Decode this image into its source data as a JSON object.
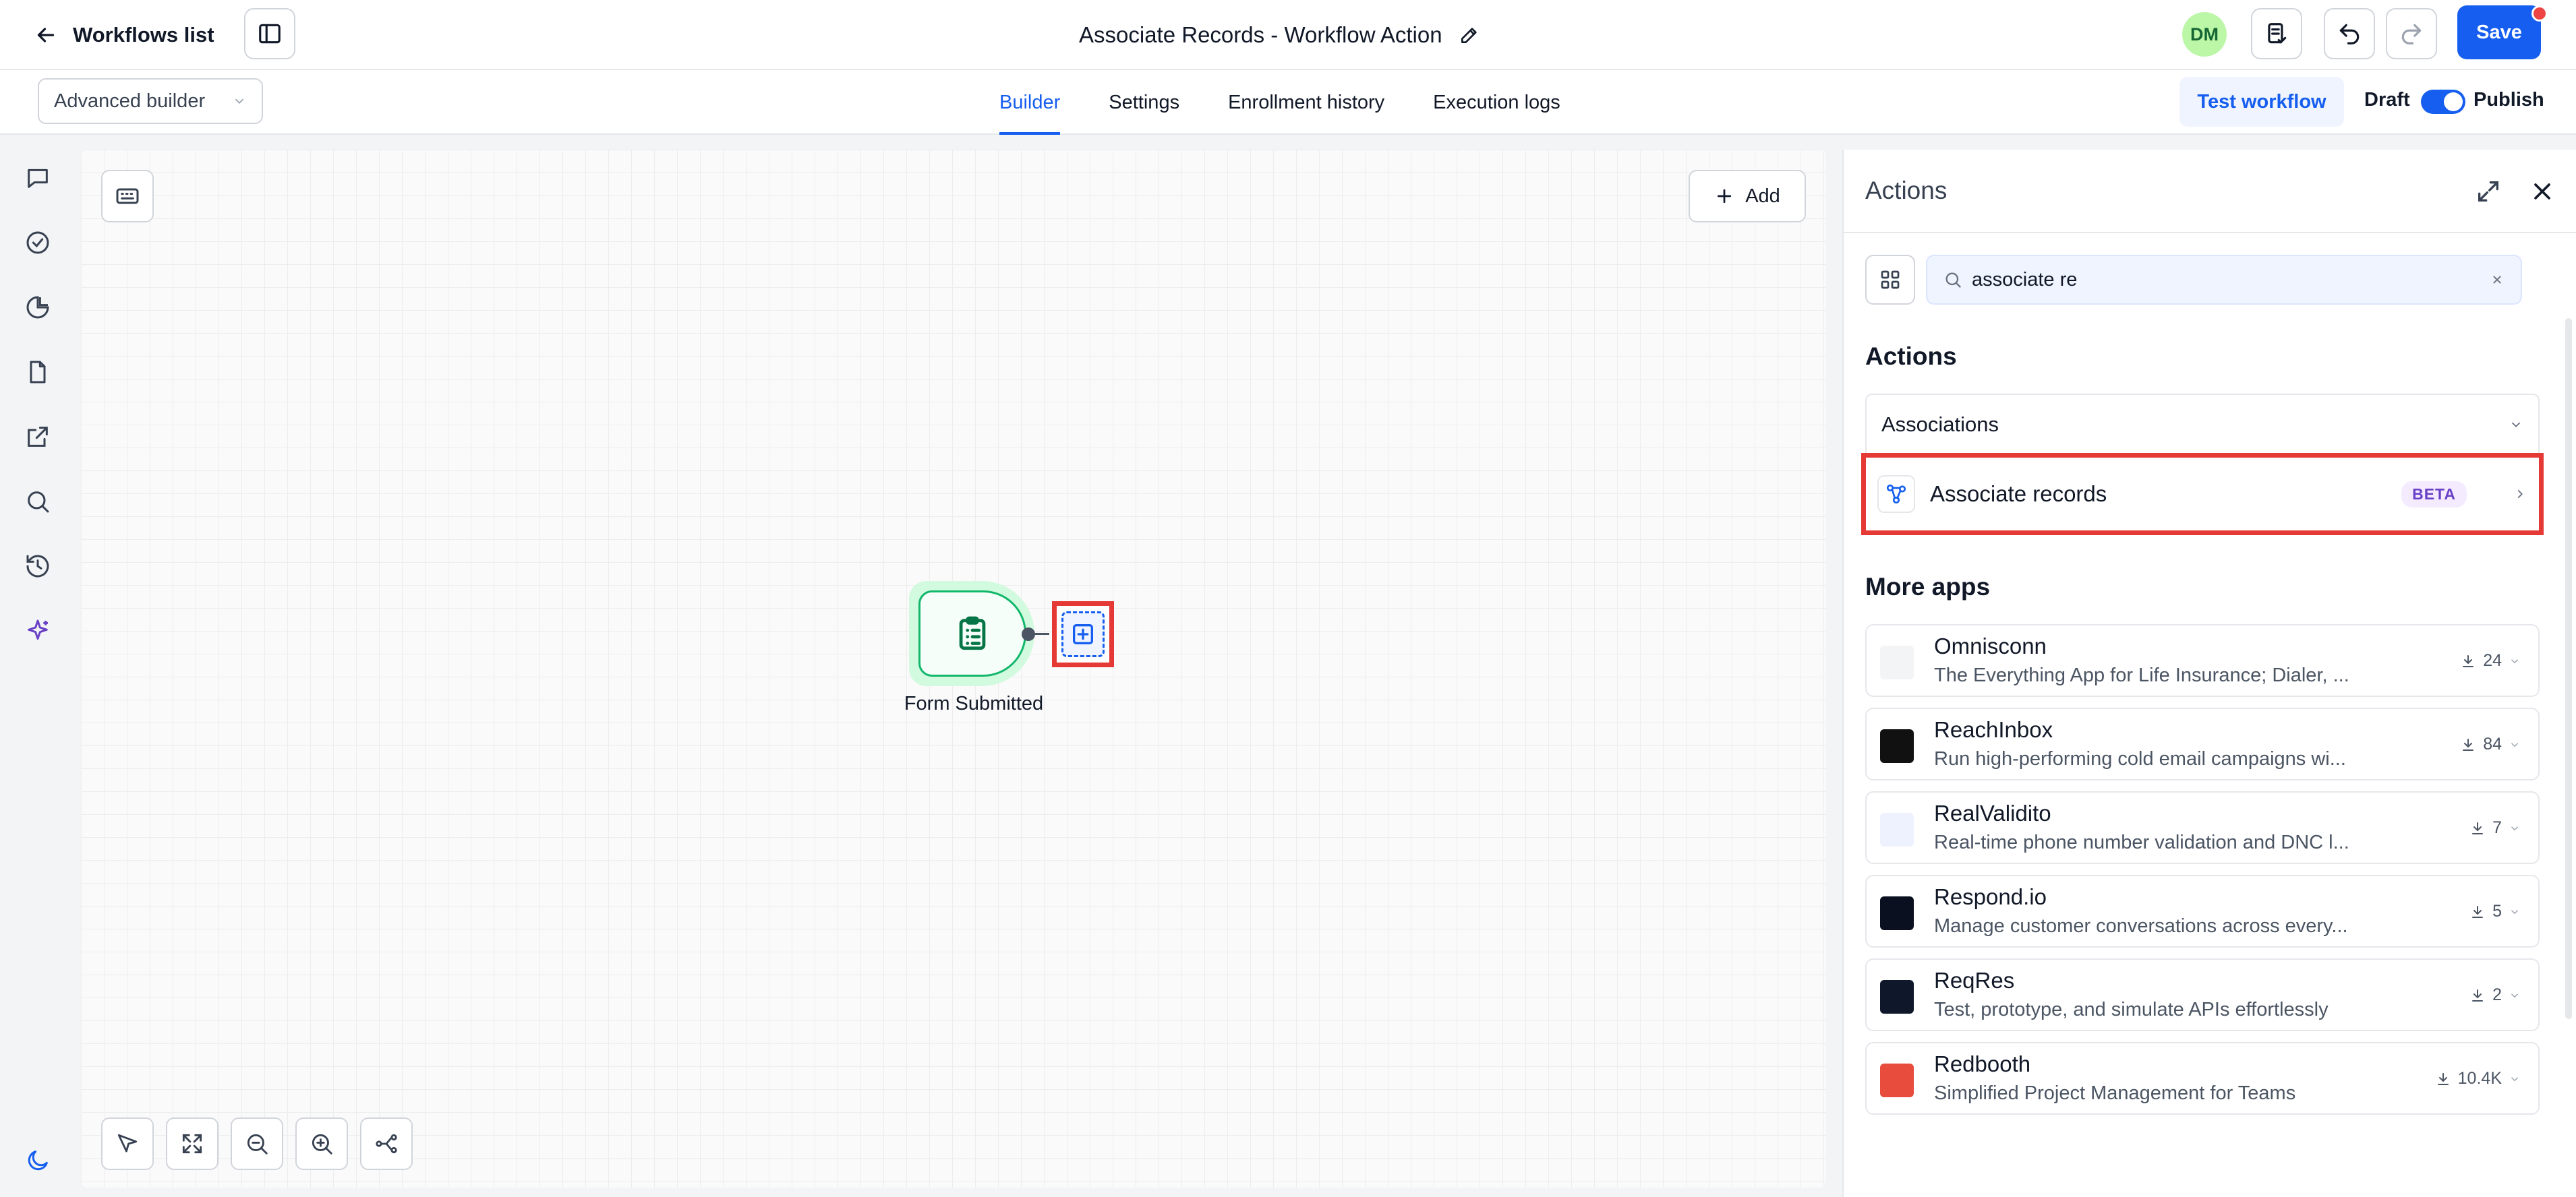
{
  "topbar": {
    "back_label": "Workflows list",
    "title": "Associate Records - Workflow Action",
    "avatar_initials": "DM",
    "save_label": "Save"
  },
  "subbar": {
    "mode_select": "Advanced builder",
    "tabs": [
      {
        "label": "Builder",
        "active": true
      },
      {
        "label": "Settings",
        "active": false
      },
      {
        "label": "Enrollment history",
        "active": false
      },
      {
        "label": "Execution logs",
        "active": false
      }
    ],
    "test_label": "Test workflow",
    "draft_label": "Draft",
    "publish_label": "Publish",
    "publish_toggle_on": true
  },
  "canvas": {
    "add_label": "Add",
    "trigger_node_label": "Form Submitted"
  },
  "panel": {
    "title": "Actions",
    "search_value": "associate re",
    "actions_heading": "Actions",
    "category": "Associations",
    "action_item": {
      "label": "Associate records",
      "badge": "BETA"
    },
    "more_apps_heading": "More apps",
    "apps": [
      {
        "name": "Omnisconn",
        "desc": "The Everything App for Life Insurance; Dialer, ...",
        "count": "24",
        "logo_color": "#f3f4f6"
      },
      {
        "name": "ReachInbox",
        "desc": "Run high-performing cold email campaigns wi...",
        "count": "84",
        "logo_color": "#111111"
      },
      {
        "name": "RealValidito",
        "desc": "Real-time phone number validation and DNC l...",
        "count": "7",
        "logo_color": "#eef2ff"
      },
      {
        "name": "Respond.io",
        "desc": "Manage customer conversations across every...",
        "count": "5",
        "logo_color": "#0b1020"
      },
      {
        "name": "ReqRes",
        "desc": "Test, prototype, and simulate APIs effortlessly",
        "count": "2",
        "logo_color": "#0f172a"
      },
      {
        "name": "Redbooth",
        "desc": "Simplified Project Management for Teams",
        "count": "10.4K",
        "logo_color": "#e74c3c"
      }
    ]
  },
  "colors": {
    "accent": "#155eef",
    "highlight": "#e53935",
    "node_green": "#12b76a"
  }
}
